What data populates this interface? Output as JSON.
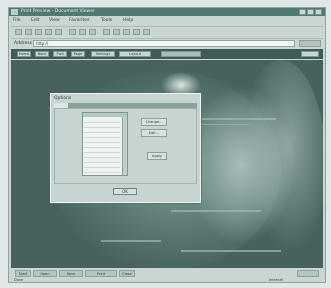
{
  "window": {
    "title": "Print Preview - Document Viewer"
  },
  "menu": [
    "File",
    "Edit",
    "View",
    "Favorites",
    "Tools",
    "Help"
  ],
  "address": {
    "label": "Address",
    "value": "http://"
  },
  "tabs": [
    "Home",
    "Back",
    "Fwd",
    "Page",
    "Settings",
    "Layout"
  ],
  "dialog": {
    "title": "Options",
    "buttons": [
      "Change...",
      "Edit...",
      "Apply"
    ],
    "ok_label": "OK"
  },
  "bottom_buttons": [
    "Start",
    "Open",
    "Save",
    "Print",
    "Close"
  ],
  "status": {
    "text": "Done",
    "right": "Internet"
  }
}
